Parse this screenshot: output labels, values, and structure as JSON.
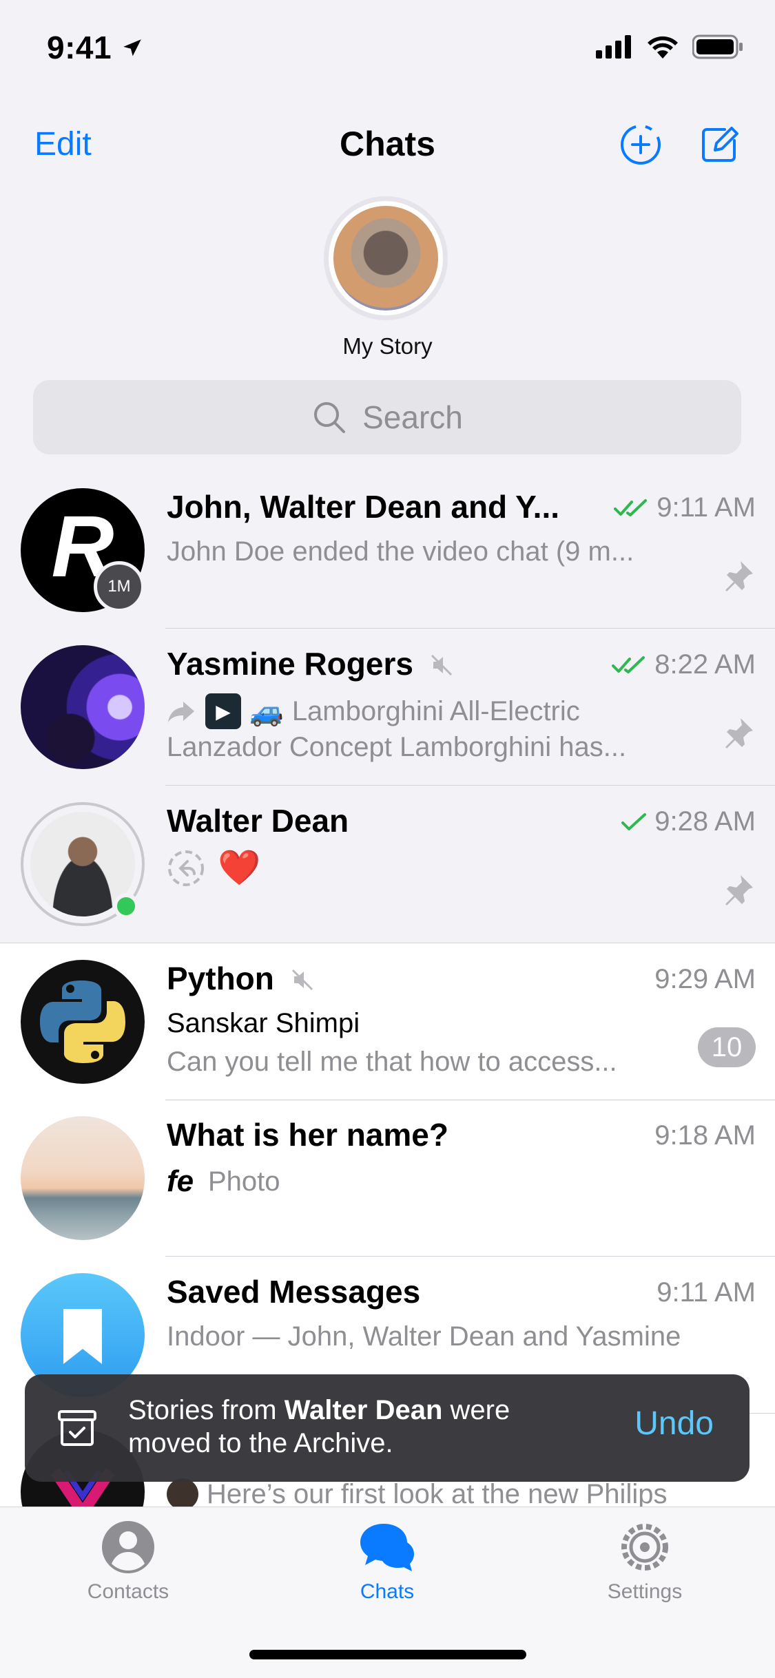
{
  "status_bar": {
    "time": "9:41"
  },
  "header": {
    "edit_label": "Edit",
    "title": "Chats"
  },
  "story": {
    "label": "My Story"
  },
  "search": {
    "placeholder": "Search"
  },
  "chats": [
    {
      "name": "John, Walter Dean and Y...",
      "time": "9:11 AM",
      "status": "read",
      "preview": "John Doe ended the video chat (9 m...",
      "pinned": true,
      "avatar_badge": "1M"
    },
    {
      "name": "Yasmine Rogers",
      "time": "8:22 AM",
      "status": "read",
      "muted": true,
      "preview_line1": "Lamborghini All-Electric",
      "preview_line2": "Lanzador Concept Lamborghini has...",
      "pinned": true
    },
    {
      "name": "Walter Dean",
      "time": "9:28 AM",
      "status": "sent",
      "preview": "❤️",
      "pinned": true,
      "online": true
    },
    {
      "name": "Python",
      "time": "9:29 AM",
      "muted": true,
      "sender": "Sanskar Shimpi",
      "preview": "Can you tell me that how to access...",
      "unread": "10"
    },
    {
      "name": "What is her name?",
      "time": "9:18 AM",
      "preview": "Photo",
      "thumb_text": "fe"
    },
    {
      "name": "Saved Messages",
      "time": "9:11 AM",
      "preview": "Indoor — John, Walter Dean and Yasmine"
    },
    {
      "name": "",
      "time": "",
      "preview": "Here’s our first look at the new Philips"
    }
  ],
  "toast": {
    "text_before": "Stories from ",
    "bold_name": "Walter Dean",
    "text_after": " were moved to the Archive.",
    "action": "Undo"
  },
  "tabs": [
    {
      "label": "Contacts",
      "active": false
    },
    {
      "label": "Chats",
      "active": true
    },
    {
      "label": "Settings",
      "active": false
    }
  ],
  "colors": {
    "accent": "#0a7aff",
    "read_check": "#2fb84f",
    "online": "#34c759",
    "undo": "#5ac8fa"
  }
}
